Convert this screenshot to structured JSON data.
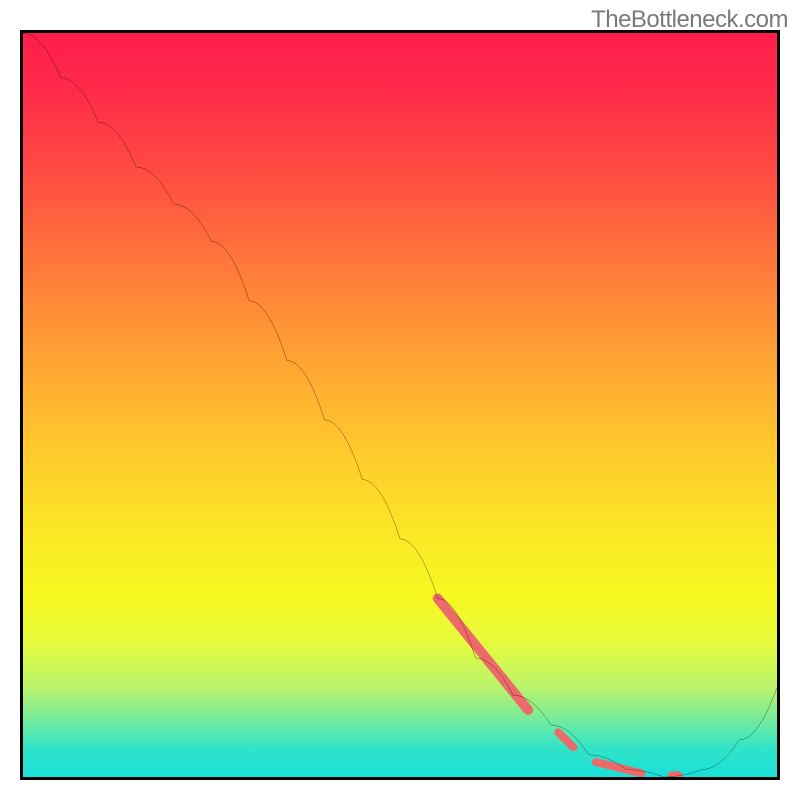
{
  "watermark": "TheBottleneck.com",
  "chart_data": {
    "type": "line",
    "title": "",
    "xlabel": "",
    "ylabel": "",
    "xlim": [
      0,
      100
    ],
    "ylim": [
      0,
      100
    ],
    "grid": false,
    "legend": false,
    "series": [
      {
        "name": "curve",
        "color": "#000000",
        "x": [
          0,
          5,
          10,
          15,
          20,
          25,
          30,
          35,
          40,
          45,
          50,
          55,
          60,
          65,
          70,
          75,
          80,
          85,
          90,
          95,
          100
        ],
        "y": [
          100,
          94,
          88,
          82,
          77,
          72,
          64,
          56,
          48,
          40,
          32,
          24,
          16,
          11,
          7,
          3,
          1,
          0,
          1,
          5,
          12
        ]
      }
    ],
    "markers": {
      "name": "highlight-band",
      "color": "#ec6a6a",
      "segments": [
        {
          "x0": 55,
          "y0": 24,
          "x1": 67,
          "y1": 9,
          "w": 10
        },
        {
          "x0": 71,
          "y0": 6,
          "x1": 73,
          "y1": 4,
          "w": 8
        },
        {
          "x0": 76,
          "y0": 2,
          "x1": 82,
          "y1": 0.5,
          "w": 8
        },
        {
          "x0": 86,
          "y0": 0.3,
          "x1": 87,
          "y1": 0.3,
          "w": 7
        }
      ]
    },
    "background_gradient": {
      "stops": [
        {
          "offset": 0,
          "color": "#ff1d4b"
        },
        {
          "offset": 20,
          "color": "#ff5041"
        },
        {
          "offset": 44,
          "color": "#ffa333"
        },
        {
          "offset": 68,
          "color": "#fbe926"
        },
        {
          "offset": 88,
          "color": "#b9f46b"
        },
        {
          "offset": 100,
          "color": "#18e0da"
        }
      ]
    }
  }
}
